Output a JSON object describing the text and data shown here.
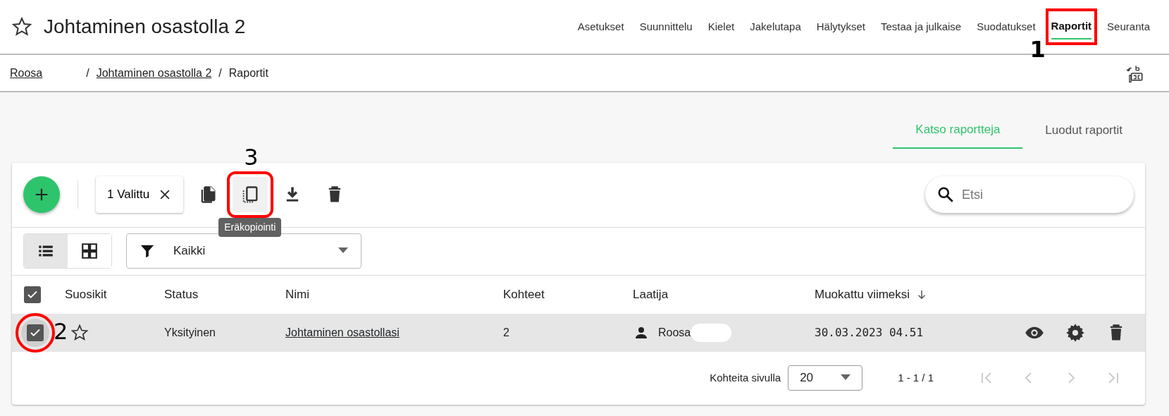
{
  "header": {
    "title": "Johtaminen osastolla 2",
    "favorite": false
  },
  "nav": [
    {
      "label": "Asetukset",
      "selected": false
    },
    {
      "label": "Suunnittelu",
      "selected": false
    },
    {
      "label": "Kielet",
      "selected": false
    },
    {
      "label": "Jakelutapa",
      "selected": false
    },
    {
      "label": "Hälytykset",
      "selected": false
    },
    {
      "label": "Testaa ja julkaise",
      "selected": false
    },
    {
      "label": "Suodatukset",
      "selected": false
    },
    {
      "label": "Raportit",
      "selected": true,
      "annotation": "1"
    },
    {
      "label": "Seuranta",
      "selected": false
    }
  ],
  "breadcrumb": [
    {
      "label": "Roosa",
      "link": true
    },
    {
      "separator": "/",
      "label": "Johtaminen osastolla 2",
      "link": true
    },
    {
      "separator": "/",
      "label": "Raportit",
      "link": false
    }
  ],
  "tabs": [
    {
      "label": "Katso raportteja",
      "selected": true
    },
    {
      "label": "Luodut raportit",
      "selected": false
    }
  ],
  "toolbar": {
    "selection": "1 Valittu",
    "actions": [
      {
        "kind": "copy"
      },
      {
        "kind": "batch-copy",
        "annotation": "3",
        "tooltip": "Eräkopiointi"
      },
      {
        "kind": "download"
      },
      {
        "kind": "delete"
      }
    ],
    "search": {
      "placeholder": "Etsi"
    }
  },
  "views": [
    {
      "kind": "list",
      "selected": true
    },
    {
      "kind": "grid",
      "selected": false
    }
  ],
  "filter": {
    "value": "Kaikki"
  },
  "table": {
    "all_checked": true,
    "columns": [
      "Suosikit",
      "Status",
      "Nimi",
      "Kohteet",
      "Laatija",
      "Muokattu viimeksi"
    ],
    "rows": [
      {
        "checked": true,
        "annotation": "2",
        "favorite": false,
        "status": "Yksityinen",
        "name": "Johtaminen osastollasi",
        "targets": "2",
        "author": "Roosa",
        "modified": "30.03.2023 04.51"
      }
    ]
  },
  "pagination": {
    "label": "Kohteita sivulla",
    "per_page": "20",
    "range": "1 - 1 / 1"
  }
}
